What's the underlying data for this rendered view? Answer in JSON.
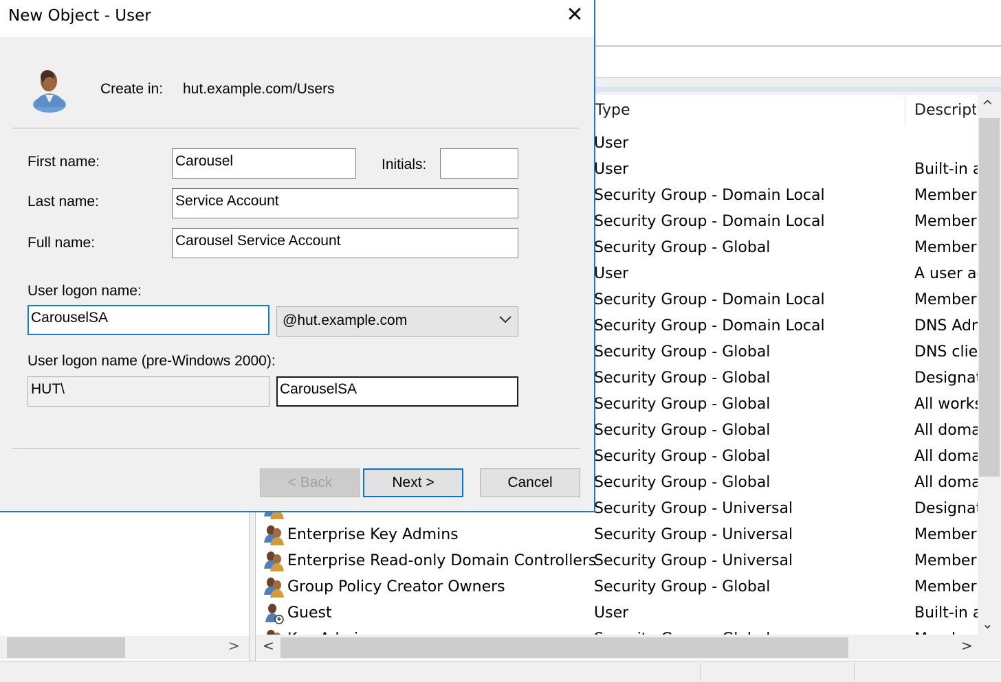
{
  "dialog": {
    "title": "New Object - User",
    "close_glyph": "✕",
    "create_in_label": "Create in:",
    "create_in_path": "hut.example.com/Users",
    "first_name_label": "First name:",
    "first_name_value": "Carousel",
    "initials_label": "Initials:",
    "initials_value": "",
    "last_name_label": "Last name:",
    "last_name_value": "Service Account",
    "full_name_label": "Full name:",
    "full_name_value": "Carousel Service Account",
    "logon_name_label": "User logon name:",
    "logon_name_value": "CarouselSA",
    "domain_selected": "@hut.example.com",
    "pre2000_label": "User logon name (pre-Windows 2000):",
    "pre2000_domain": "HUT\\",
    "pre2000_value": "CarouselSA",
    "back_label": "< Back",
    "next_label": "Next >",
    "cancel_label": "Cancel",
    "icon": "user-icon"
  },
  "list": {
    "columns": {
      "type": "Type",
      "description": "Descripti"
    },
    "rows": [
      {
        "name": "",
        "type": "User",
        "desc": "",
        "icon": ""
      },
      {
        "name": "",
        "type": "User",
        "desc": "Built-in a",
        "icon": ""
      },
      {
        "name": "",
        "type": "Security Group - Domain Local",
        "desc": "Member",
        "icon": ""
      },
      {
        "name": "",
        "type": "Security Group - Domain Local",
        "desc": "Member",
        "icon": ""
      },
      {
        "name": "",
        "type": "Security Group - Global",
        "desc": "Member",
        "icon": ""
      },
      {
        "name": "",
        "type": "User",
        "desc": "A user ac",
        "icon": ""
      },
      {
        "name": "",
        "type": "Security Group - Domain Local",
        "desc": "Member",
        "icon": ""
      },
      {
        "name": "",
        "type": "Security Group - Domain Local",
        "desc": "DNS Adr",
        "icon": ""
      },
      {
        "name": "",
        "type": "Security Group - Global",
        "desc": "DNS clier",
        "icon": ""
      },
      {
        "name": "",
        "type": "Security Group - Global",
        "desc": "Designat",
        "icon": ""
      },
      {
        "name": "",
        "type": "Security Group - Global",
        "desc": "All works",
        "icon": ""
      },
      {
        "name": "",
        "type": "Security Group - Global",
        "desc": "All doma",
        "icon": ""
      },
      {
        "name": "",
        "type": "Security Group - Global",
        "desc": "All doma",
        "icon": ""
      },
      {
        "name": "",
        "type": "Security Group - Global",
        "desc": "All doma",
        "icon": ""
      },
      {
        "name": "",
        "type": "Security Group - Universal",
        "desc": "Designat",
        "icon": "group-icon"
      },
      {
        "name": "Enterprise Key Admins",
        "type": "Security Group - Universal",
        "desc": "Member",
        "icon": "group-icon"
      },
      {
        "name": "Enterprise Read-only Domain Controllers",
        "type": "Security Group - Universal",
        "desc": "Member",
        "icon": "group-icon"
      },
      {
        "name": "Group Policy Creator Owners",
        "type": "Security Group - Global",
        "desc": "Member",
        "icon": "group-icon"
      },
      {
        "name": "Guest",
        "type": "User",
        "desc": "Built-in a",
        "icon": "user-disabled-icon"
      },
      {
        "name": "Key Admins",
        "type": "Security Group - Global",
        "desc": "Member",
        "icon": "group-icon"
      }
    ]
  },
  "scroll": {
    "up": "^",
    "down": "⌄",
    "left": "<",
    "right": ">"
  }
}
